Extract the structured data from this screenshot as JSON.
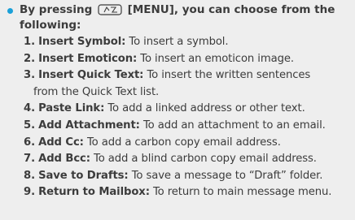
{
  "intro": {
    "line1_before": "By pressing",
    "menu_key": "[MENU], you can choose from the",
    "line2": "following:",
    "icon": "menu-key-icon"
  },
  "accent_color": "#1aa0d8",
  "items": [
    {
      "num": "1.",
      "term": "Insert Symbol:",
      "desc": "To insert a symbol.",
      "cont": ""
    },
    {
      "num": "2.",
      "term": "Insert Emoticon:",
      "desc": "To insert an emoticon image.",
      "cont": ""
    },
    {
      "num": "3.",
      "term": "Insert Quick Text:",
      "desc": "To insert the written sentences",
      "cont": "from the Quick Text list."
    },
    {
      "num": "4.",
      "term": "Paste Link:",
      "desc": "To add a linked address or other text.",
      "cont": ""
    },
    {
      "num": "5.",
      "term": "Add Attachment:",
      "desc": "To add an attachment to an email.",
      "cont": ""
    },
    {
      "num": "6.",
      "term": "Add Cc:",
      "desc": "To add a carbon copy email address.",
      "cont": ""
    },
    {
      "num": "7.",
      "term": "Add Bcc:",
      "desc": "To add a blind carbon copy email address.",
      "cont": ""
    },
    {
      "num": "8.",
      "term": "Save to Drafts:",
      "desc": "To save a message to “Draft” folder.",
      "cont": ""
    },
    {
      "num": "9.",
      "term": "Return to Mailbox:",
      "desc": "To return to main message menu.",
      "cont": ""
    }
  ]
}
